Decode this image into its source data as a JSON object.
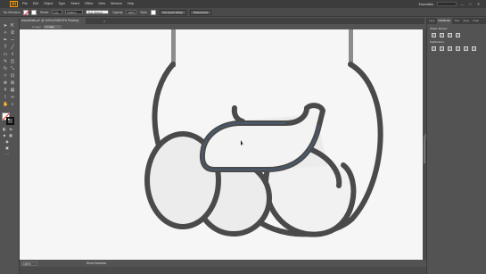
{
  "menu": {
    "logo": "Ai",
    "items": [
      "File",
      "Edit",
      "Object",
      "Type",
      "Select",
      "Effect",
      "View",
      "Window",
      "Help"
    ],
    "workspace": "Essentials",
    "window_buttons": [
      "—",
      "□",
      "✕"
    ]
  },
  "control": {
    "selection_label": "No Selection",
    "stroke_label": "Stroke:",
    "stroke_value": "1 pt",
    "profile_value": "Uniform",
    "brush_value": "5 pt. Round",
    "opacity_label": "Opacity:",
    "opacity_value": "100%",
    "style_label": "Style:",
    "doc_setup_button": "Document Setup",
    "preferences_button": "Preferences"
  },
  "document": {
    "tab_title": "showelbelts.ai* @ 100% (RGB/GPU Preview)",
    "tab_close": "×",
    "artboard_label": "1 Layer",
    "artboard_select": "1 Image"
  },
  "status": {
    "zoom": "100%",
    "tool": "Direct Selection"
  },
  "panel": {
    "tabs": [
      "Laye",
      "Pathfinder",
      "Tran",
      "Appe",
      "Grap"
    ],
    "active_tab": "Pathfinder",
    "shape_modes_label": "Shape Modes:",
    "pathfinders_label": "Pathfinders:"
  },
  "colors": {
    "outline": "#4a4a4a",
    "fill_light": "#ececec",
    "fill_front": "#f1f1f1",
    "highlight": "#4a5a6e",
    "canvas": "#f6f6f6",
    "accent": "#ff9a00"
  }
}
